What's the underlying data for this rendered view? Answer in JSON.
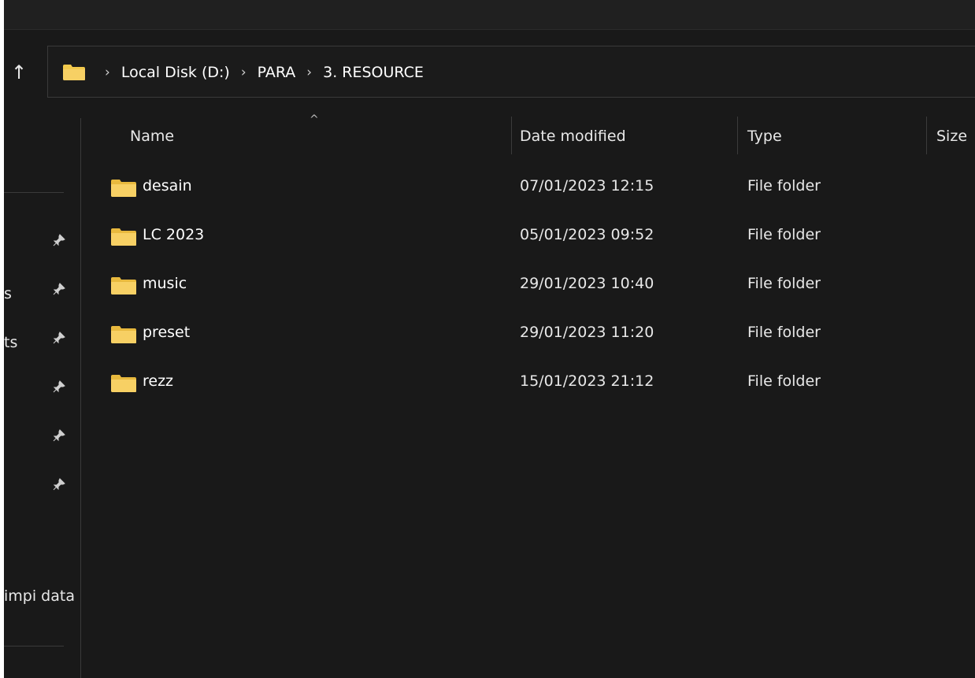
{
  "colors": {
    "background": "#191919",
    "folder": "#f2c94c",
    "border": "#3a3a3a"
  },
  "nav_button": {
    "up_glyph": "↑"
  },
  "address_bar": {
    "folder_icon": "folder-icon",
    "separator": "›",
    "crumbs": [
      "Local Disk (D:)",
      "PARA",
      "3. RESOURCE"
    ]
  },
  "sidebar": {
    "pin_glyph": "📌",
    "fragments": [
      "s",
      "ts",
      "impi data"
    ]
  },
  "columns": {
    "name": "Name",
    "date": "Date modified",
    "type": "Type",
    "size": "Size",
    "sort_glyph": "^"
  },
  "rows": [
    {
      "name": "desain",
      "date": "07/01/2023 12:15",
      "type": "File folder"
    },
    {
      "name": "LC 2023",
      "date": "05/01/2023 09:52",
      "type": "File folder"
    },
    {
      "name": "music",
      "date": "29/01/2023 10:40",
      "type": "File folder"
    },
    {
      "name": "preset",
      "date": "29/01/2023 11:20",
      "type": "File folder"
    },
    {
      "name": "rezz",
      "date": "15/01/2023 21:12",
      "type": "File folder"
    }
  ]
}
